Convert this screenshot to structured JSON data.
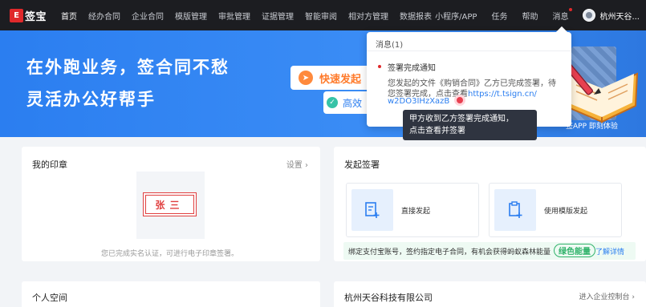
{
  "nav": {
    "logo_mark": "E",
    "logo_text": "签宝",
    "items": [
      "首页",
      "经办合同",
      "企业合同",
      "模版管理",
      "审批管理",
      "证据管理",
      "智能审阅",
      "相对方管理",
      "数据报表"
    ],
    "right": {
      "app": "小程序/APP",
      "task": "任务",
      "help": "帮助",
      "messages": "消息",
      "user": "杭州天谷..."
    }
  },
  "banner": {
    "line1": "在外跑业务，签合同不愁",
    "line2": "灵活办公好帮手",
    "quick_btn": "快速发起",
    "efficient_btn": "高效",
    "app_hint": "签APP 即刻体验"
  },
  "popup": {
    "header": "消息(1)",
    "title": "签署完成通知",
    "line1": "您发起的文件《购销合同》乙方已完成签署，待",
    "line2_text": "您签署完成，点击查看",
    "line2_link": "https://t.tsign.cn/",
    "line3_link": "w2DO3IHzXazB"
  },
  "tooltip": {
    "line1": "甲方收到乙方签署完成通知，",
    "line2": "点击查看并签署"
  },
  "my_seal": {
    "title": "我的印章",
    "setting": "设置 ›",
    "seal_name": "张三",
    "tip": "您已完成实名认证，可进行电子印章签署。"
  },
  "initiate": {
    "title": "发起签署",
    "direct": "直接发起",
    "template": "使用模版发起",
    "promo": "绑定支付宝账号，签约指定电子合同，有机会获得蚂蚁森林能量",
    "badge": "绿色能量",
    "learn_more": "了解详情"
  },
  "personal": {
    "title": "个人空间"
  },
  "company": {
    "title": "杭州天谷科技有限公司",
    "enter": "进入企业控制台 ›"
  },
  "colors": {
    "nav_bg": "#1c1d21",
    "banner": "#2b7ef0",
    "brand_red": "#e0292b",
    "green": "#31b36b"
  }
}
